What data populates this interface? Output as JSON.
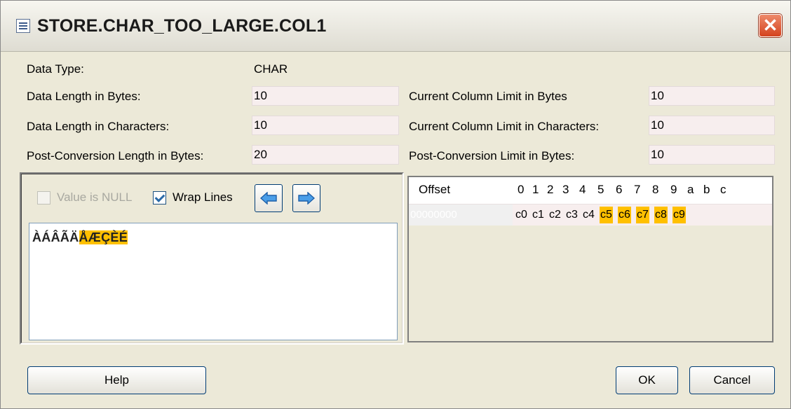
{
  "window": {
    "title": "STORE.CHAR_TOO_LARGE.COL1",
    "close_label": "✕"
  },
  "props": {
    "data_type_label": "Data Type:",
    "data_type_value": "CHAR",
    "data_len_bytes_label": "Data Length in Bytes:",
    "data_len_bytes_value": "10",
    "data_len_chars_label": "Data Length in Characters:",
    "data_len_chars_value": "10",
    "post_conv_len_label": "Post-Conversion Length in Bytes:",
    "post_conv_len_value": "20",
    "col_limit_bytes_label": "Current Column Limit in Bytes",
    "col_limit_bytes_value": "10",
    "col_limit_chars_label": "Current Column Limit in Characters:",
    "col_limit_chars_value": "10",
    "post_conv_limit_label": "Post-Conversion Limit in Bytes:",
    "post_conv_limit_value": "10"
  },
  "editor": {
    "value_null_label": "Value is NULL",
    "value_null_checked": false,
    "wrap_lines_label": "Wrap Lines",
    "wrap_lines_checked": true,
    "text_normal": "ÀÁÂÃÄ",
    "text_highlight": "ÅÆÇÈÉ"
  },
  "hex_view": {
    "offset_header": "Offset",
    "columns": [
      "0",
      "1",
      "2",
      "3",
      "4",
      "5",
      "6",
      "7",
      "8",
      "9",
      "a",
      "b",
      "c"
    ],
    "row_offset": "00000000",
    "bytes": [
      "c0",
      "c1",
      "c2",
      "c3",
      "c4",
      "c5",
      "c6",
      "c7",
      "c8",
      "c9"
    ],
    "highlight_from_index": 5
  },
  "buttons": {
    "help": "Help",
    "ok": "OK",
    "cancel": "Cancel"
  },
  "colors": {
    "highlight": "#ffc000",
    "field_bg": "#f7eeee"
  },
  "icons": {
    "title": "table-icon",
    "left": "arrow-left-icon",
    "right": "arrow-right-icon"
  }
}
